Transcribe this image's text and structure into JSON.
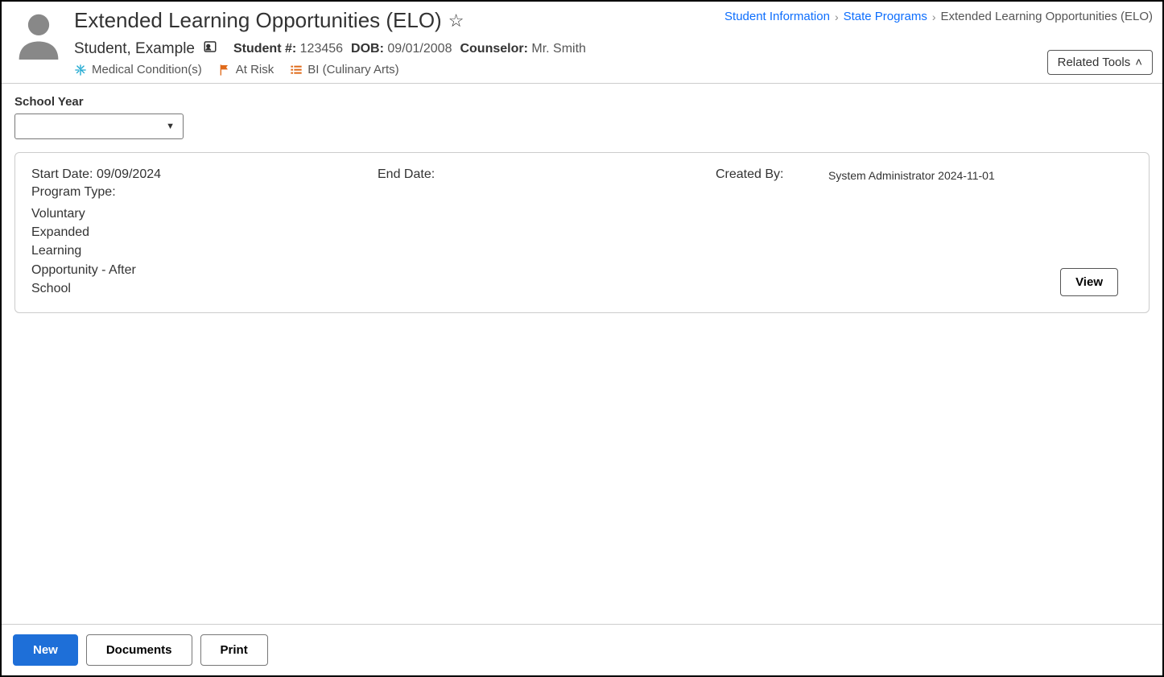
{
  "breadcrumb": {
    "items": [
      {
        "label": "Student Information",
        "link": true
      },
      {
        "label": "State Programs",
        "link": true
      },
      {
        "label": "Extended Learning Opportunities (ELO)",
        "link": false
      }
    ]
  },
  "header": {
    "page_title": "Extended Learning Opportunities (ELO)",
    "student_name": "Student, Example",
    "student_number_label": "Student #:",
    "student_number": "123456",
    "dob_label": "DOB:",
    "dob": "09/01/2008",
    "counselor_label": "Counselor:",
    "counselor": "Mr. Smith",
    "flags": {
      "medical": "Medical Condition(s)",
      "at_risk": "At Risk",
      "bi": "BI (Culinary Arts)"
    },
    "related_tools_label": "Related Tools"
  },
  "filter": {
    "label": "School Year",
    "value": ""
  },
  "record": {
    "start_date_label": "Start Date:",
    "start_date": "09/09/2024",
    "end_date_label": "End Date:",
    "end_date": "",
    "created_by_label": "Created By:",
    "created_by": "System Administrator 2024-11-01",
    "program_type_label": "Program Type:",
    "program_type": "Voluntary Expanded Learning Opportunity - After School",
    "view_label": "View"
  },
  "footer": {
    "new_label": "New",
    "documents_label": "Documents",
    "print_label": "Print"
  }
}
